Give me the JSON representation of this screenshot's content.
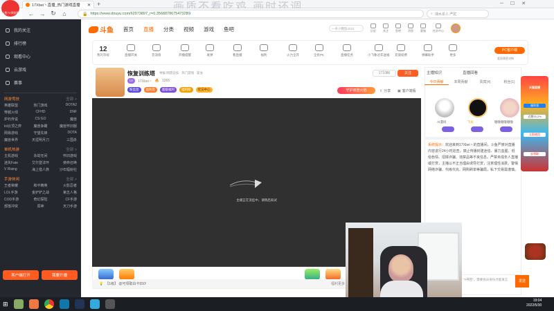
{
  "browser": {
    "logo_text": "斗鱼TV浏览器",
    "tab_title": "17Xbei丶直播_热门游戏直播",
    "url": "https://www.douyu.com/62973897_r=0.35688786754732B9",
    "search_placeholder": "湘水杀人 严驼",
    "watermark": "画质不看吃鸡 画时还调"
  },
  "sidebar": {
    "items": [
      {
        "label": "我的关注",
        "icon": "heart-icon"
      },
      {
        "label": "排行榜",
        "icon": "rank-icon"
      },
      {
        "label": "观看中心",
        "icon": "eye-icon"
      },
      {
        "label": "云游戏",
        "icon": "gamepad-icon"
      },
      {
        "label": "赛事",
        "icon": "trophy-icon"
      }
    ],
    "sections": [
      {
        "title": "网游竞技",
        "more": "全部 >",
        "games": [
          "英雄联盟",
          "热门游戏",
          "DOTA2",
          "穿越火线",
          "CFHD",
          "DNF",
          "炉石传说",
          "CS:GO",
          "魔兽",
          "lol云顶之弈",
          "魔兽争霸",
          "魔兽怀旧服",
          "网易游戏",
          "守望先锋",
          "DOTA",
          "魔兽世界",
          "天涯明月刀",
          "三国杀"
        ]
      },
      {
        "title": "单机热游",
        "more": "全部 >",
        "games": [
          "主机游戏",
          "永劫无间",
          "怀旧游戏",
          "迷失Fate",
          "艾尔登法环",
          "使命召唤",
          "V Rising",
          "海上猎人族",
          "沙石辐射社"
        ]
      },
      {
        "title": "手游休闲",
        "more": "全部 >",
        "games": [
          "王者荣耀",
          "和平精英",
          "火影忍者",
          "LOL手游",
          "金铲铲之战",
          "第五人格",
          "COD手游",
          "奇幻探险",
          "CF手游",
          "部落冲突",
          "原神",
          "天刀手游"
        ]
      }
    ],
    "btn_open": "客户端打开",
    "btn_live": "我要开播"
  },
  "header": {
    "logo": "斗鱼",
    "nav": [
      "首页",
      "直播",
      "分类",
      "视频",
      "游戏",
      "鱼吧"
    ],
    "search_placeholder": "一条小鲤鱼2022",
    "icons": [
      "历史",
      "关注",
      "鱼吧",
      "消息",
      "客服",
      "任务中心"
    ]
  },
  "toolbar": {
    "level": "12",
    "level_label": "我的等级",
    "tools": [
      "直播开关",
      "音浪值",
      "开播提醒",
      "发弹",
      "看直播",
      "福利",
      "火力全开",
      "全民PK",
      "直播任务",
      "小飞象过年送福",
      "充值续费",
      "弹幕助手",
      "更多"
    ],
    "pc_btn": "PC客户端",
    "pc_sub": "看直播更流畅"
  },
  "streamer": {
    "room_title": "恢复训练塔",
    "meta": "举报 网游竞技 · 热门游戏 · 斩女",
    "name": "17Xbei丶",
    "followers": "1265",
    "fans_count": "171086",
    "follow_btn": "关注",
    "share": "分享",
    "client": "客户端看",
    "badges": [
      "粉丝团",
      "福利签",
      "超级福利",
      "福利榜",
      "玩法中心"
    ],
    "hot_btn": "守护双倍火焰"
  },
  "video": {
    "status": "主播正在流挂中，请稍后再试"
  },
  "chat_bar": {
    "placeholder": "【1级】 @可领取白卡650!",
    "more": "福利更多"
  },
  "right_panel": {
    "tabs": [
      "今日贡献",
      "本周贡献",
      "贵宾(4)",
      "粉丝(1)"
    ],
    "top_links": [
      "主播知识",
      "直播回看"
    ],
    "rank_names": [
      "AI漫闷",
      "飞龙",
      "嗷嗷嗷嗷嗷嗷"
    ],
    "system_title": "系统提示：",
    "system_msg": "欢迎来到17Xbei丶的直播间。斗鱼严禁对直播内容进行24小时巡查，禁止传播封建迷信、暴力血腥、低俗色情、招嫖诈骗、违禁品等不良信息。严禁未成年人直播或打赏，主播以不正当理由诱导打赏，注意理性消费。警惕网络诈骗、代练代充、网购刷单等骗局，私下交易需谨慎。",
    "send": "发送",
    "input_hint": "\"#神回\"，需要会员身份才能发言"
  },
  "promo": {
    "labels": [
      "天猫直播",
      "福利领",
      "近期33.2%",
      "立即使用",
      "去领取"
    ]
  },
  "taskbar": {
    "time": "19:04",
    "date": "2022/5/30"
  }
}
